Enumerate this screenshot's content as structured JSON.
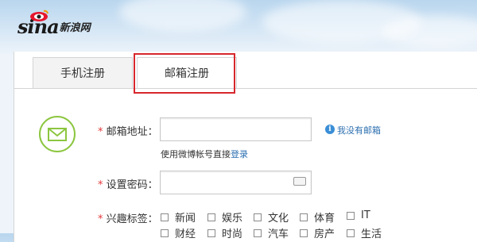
{
  "brand": {
    "logo_text": "sina",
    "logo_cn": "新浪网"
  },
  "tabs": [
    {
      "label": "手机注册",
      "active": false
    },
    {
      "label": "邮箱注册",
      "active": true
    }
  ],
  "form": {
    "email": {
      "required_mark": "*",
      "label": "邮箱地址：",
      "value": ""
    },
    "no_email_link": "我没有邮箱",
    "hint_prefix": "使用微博帐号直接",
    "hint_link": "登录",
    "password": {
      "required_mark": "*",
      "label": "设置密码：",
      "value": ""
    },
    "interests": {
      "required_mark": "*",
      "label": "兴趣标签：",
      "row1": [
        "新闻",
        "娱乐",
        "文化",
        "体育",
        "IT"
      ],
      "row2": [
        "财经",
        "时尚",
        "汽车",
        "房产",
        "生活"
      ]
    }
  },
  "colors": {
    "highlight": "#d7272d",
    "accent_green": "#8cc63f",
    "link": "#2c6fb0",
    "required": "#e4393c"
  }
}
